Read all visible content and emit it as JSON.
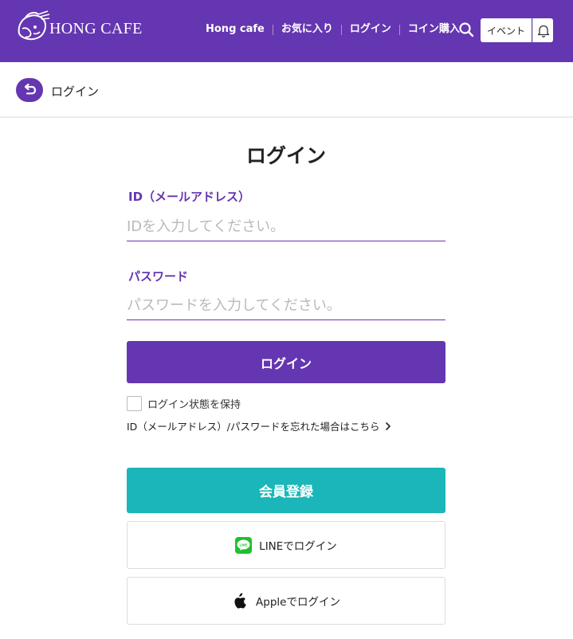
{
  "header": {
    "logo_text": "HONG CAFE",
    "nav": [
      "Hong cafe",
      "お気に入り",
      "ログイン",
      "コイン購入"
    ],
    "event_label": "イベント",
    "brand_color": "#6536b1"
  },
  "breadcrumb": {
    "label": "ログイン"
  },
  "form": {
    "title": "ログイン",
    "id_label": "ID（メールアドレス）",
    "id_placeholder": "IDを入力してください。",
    "password_label": "パスワード",
    "password_placeholder": "パスワードを入力してください。",
    "login_button": "ログイン",
    "keep_login": "ログイン状態を保持",
    "keep_login_checked": false,
    "forgot_link": "ID（メールアドレス）/パスワードを忘れた場合はこちら"
  },
  "signup": {
    "register_button": "会員登録",
    "register_color": "#1ab6b9",
    "line_login": "LINEでログイン",
    "line_icon_text": "LINE",
    "apple_login": "Appleでログイン"
  }
}
